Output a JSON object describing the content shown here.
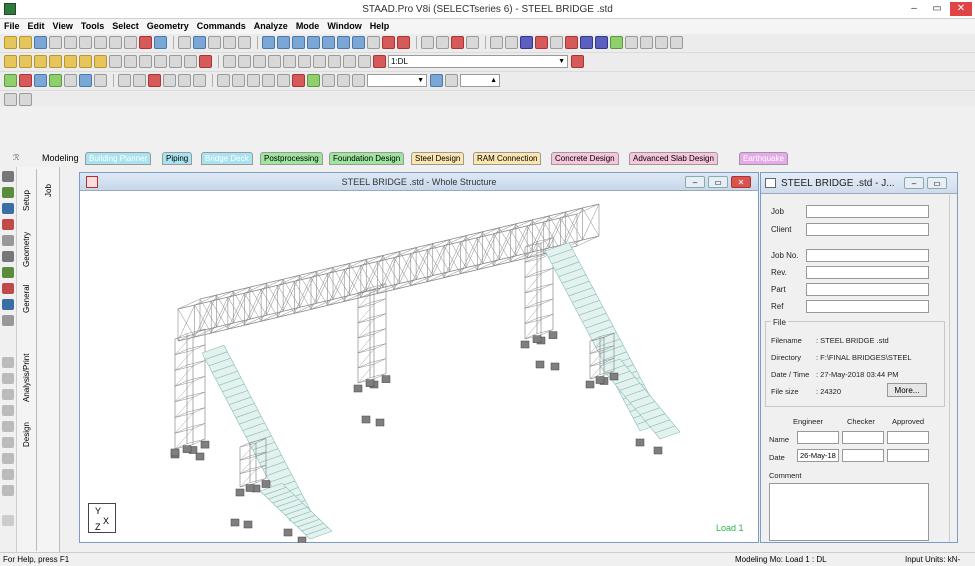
{
  "window": {
    "title": "STAAD.Pro V8i (SELECTseries 6) - STEEL BRIDGE .std",
    "minimize": "–",
    "restore": "▭",
    "close": "✕"
  },
  "menu": [
    "File",
    "Edit",
    "View",
    "Tools",
    "Select",
    "Geometry",
    "Commands",
    "Analyze",
    "Mode",
    "Window",
    "Help"
  ],
  "toolbar": {
    "units_value": "1:DL",
    "small_value": "1"
  },
  "mode_tabs": {
    "label": "Modeling",
    "tabs": [
      {
        "label": "Building Planner",
        "color": "#a8e3ef",
        "text_color": "#ffffff"
      },
      {
        "label": "Piping",
        "color": "#a8e3ef",
        "text_color": "#000000"
      },
      {
        "label": "Bridge Deck",
        "color": "#a8e3ef",
        "text_color": "#ffffff"
      },
      {
        "label": "Postprocessing",
        "color": "#9fe59f",
        "text_color": "#000000"
      },
      {
        "label": "Foundation Design",
        "color": "#9fe59f",
        "text_color": "#000000"
      },
      {
        "label": "Steel Design",
        "color": "#fbe6b0",
        "text_color": "#000000"
      },
      {
        "label": "RAM Connection",
        "color": "#fbe6b0",
        "text_color": "#000000"
      },
      {
        "label": "Concrete Design",
        "color": "#f7c6dd",
        "text_color": "#000000"
      },
      {
        "label": "Advanced Slab Design",
        "color": "#f7c6dd",
        "text_color": "#000000"
      },
      {
        "label": "Earthquake",
        "color": "#e7a9e9",
        "text_color": "#ffffff"
      }
    ]
  },
  "page_control": {
    "tabs_outer": [
      "Setup",
      "Geometry",
      "General",
      "Analysis/Print",
      "Design"
    ],
    "tab_inner": "Job"
  },
  "viewport": {
    "title": "STEEL BRIDGE .std - Whole Structure",
    "load_label": "Load 1",
    "axis_y": "Y",
    "axis_x": "X",
    "axis_z": "Z"
  },
  "job_panel": {
    "title": "STEEL BRIDGE .std - J...",
    "fields": [
      "Job",
      "Client",
      "Job No.",
      "Rev.",
      "Part",
      "Ref"
    ],
    "file_group": "File",
    "file_info": [
      {
        "label": "Filename",
        "value": ": STEEL BRIDGE .std"
      },
      {
        "label": "Directory",
        "value": ": F:\\FINAL BRIDGES\\STEEL"
      },
      {
        "label": "Date / Time",
        "value": ": 27-May-2018   03:44 PM"
      },
      {
        "label": "File size",
        "value": ": 24320"
      }
    ],
    "more_button": "More...",
    "col_headers": [
      "Engineer",
      "Checker",
      "Approved"
    ],
    "name_label": "Name",
    "date_label": "Date",
    "date_value": "26-May-18",
    "comment_label": "Comment"
  },
  "status": {
    "help": "For Help, press F1",
    "mode": "Modeling Mo: Load 1 : DL",
    "units": "Input Units: kN-"
  },
  "colors": {
    "structure": "#8a8a8a",
    "stairs": "#8dbfb9",
    "support": "#7f7f7f",
    "load": "#2cb34a"
  }
}
